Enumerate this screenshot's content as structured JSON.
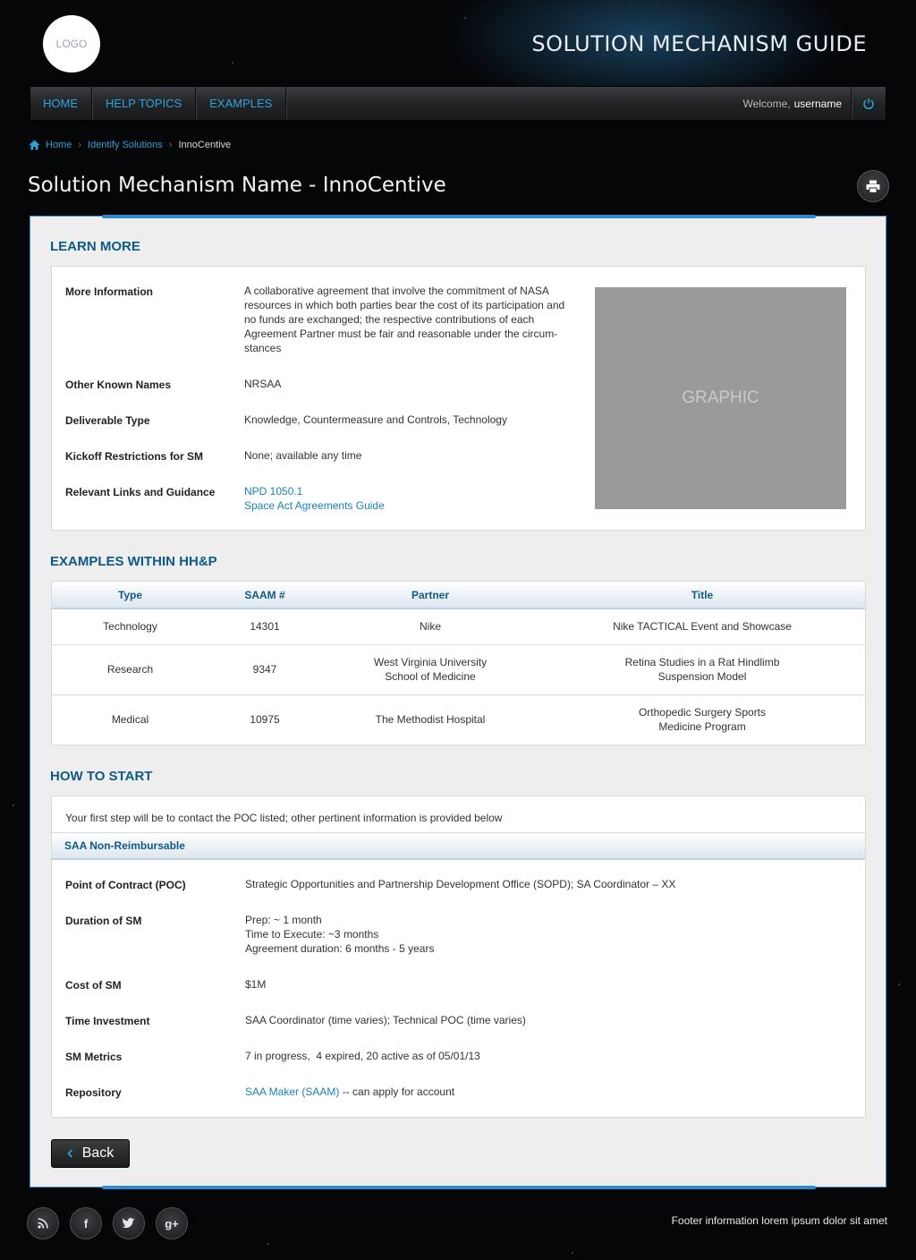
{
  "header": {
    "logo_text": "LOGO",
    "site_title": "SOLUTION MECHANISM GUIDE"
  },
  "nav": {
    "items": [
      "HOME",
      "HELP TOPICS",
      "EXAMPLES"
    ],
    "welcome_prefix": "Welcome,",
    "username": "username",
    "power_icon": "power-icon"
  },
  "breadcrumb": {
    "home": "Home",
    "identify": "Identify Solutions",
    "current": "InnoCentive"
  },
  "page": {
    "title": "Solution Mechanism Name - InnoCentive",
    "print_icon": "print-icon"
  },
  "learn_more": {
    "title": "LEARN MORE",
    "graphic_label": "GRAPHIC",
    "more_info_label": "More Information",
    "more_info_value": "A collaborative agreement that involve the commitment of NASA resources in which both parties bear the cost of its participation and no funds are exchanged; the respective contributions of each Agreement Partner must be fair and reasonable under the circum-stances",
    "other_names_label": "Other Known Names",
    "other_names_value": "NRSAA",
    "deliverable_label": "Deliverable Type",
    "deliverable_value": "Knowledge, Countermeasure and Controls, Technology",
    "kickoff_label": "Kickoff Restrictions for SM",
    "kickoff_value": "None; available any time",
    "links_label": "Relevant Links and Guidance",
    "link_1": "NPD 1050.1",
    "link_2": "Space Act Agreements Guide"
  },
  "examples": {
    "title": "EXAMPLES WITHIN HH&P",
    "columns": [
      "Type",
      "SAAM #",
      "Partner",
      "Title"
    ],
    "rows": [
      {
        "type": "Technology",
        "saam": "14301",
        "partner_1": "Nike",
        "partner_2": "",
        "title_1": "Nike TACTICAL Event and Showcase",
        "title_2": ""
      },
      {
        "type": "Research",
        "saam": "9347",
        "partner_1": "West Virginia University",
        "partner_2": "School of Medicine",
        "title_1": "Retina Studies in a Rat Hindlimb",
        "title_2": "Suspension Model"
      },
      {
        "type": "Medical",
        "saam": "10975",
        "partner_1": "The Methodist Hospital",
        "partner_2": "",
        "title_1": "Orthopedic Surgery Sports",
        "title_2": "Medicine Program"
      }
    ]
  },
  "how_to_start": {
    "title": "HOW TO START",
    "intro": "Your first step will be to contact the POC listed; other pertinent information is provided below",
    "subheader": "SAA Non-Reimbursable",
    "poc_label": "Point of Contract (POC)",
    "poc_value": "Strategic Opportunities and Partnership Development Office (SOPD); SA Coordinator – XX",
    "duration_label": "Duration of SM",
    "duration_1": "Prep: ~ 1 month",
    "duration_2": "Time to Execute: ~3 months",
    "duration_3": "Agreement duration: 6 months - 5 years",
    "cost_label": "Cost of SM",
    "cost_value": "$1M",
    "time_label": "Time Investment",
    "time_value": "SAA Coordinator (time varies); Technical POC (time varies)",
    "metrics_label": "SM Metrics",
    "metrics_value": "7 in progress,  4 expired, 20 active as of 05/01/13",
    "repo_label": "Repository",
    "repo_link": "SAA Maker (SAAM)",
    "repo_suffix": " -- can apply for account"
  },
  "back_button": "Back",
  "footer": {
    "social": [
      {
        "name": "rss-icon",
        "glyph": "◉"
      },
      {
        "name": "facebook-icon",
        "glyph": "f"
      },
      {
        "name": "twitter-icon",
        "glyph": "🐦"
      },
      {
        "name": "google-plus-icon",
        "glyph": "g+"
      }
    ],
    "text": "Footer information lorem ipsum dolor sit amet"
  },
  "colors": {
    "accent": "#2fa3e0",
    "section_title": "#0e5a86",
    "link": "#1a83b9"
  }
}
